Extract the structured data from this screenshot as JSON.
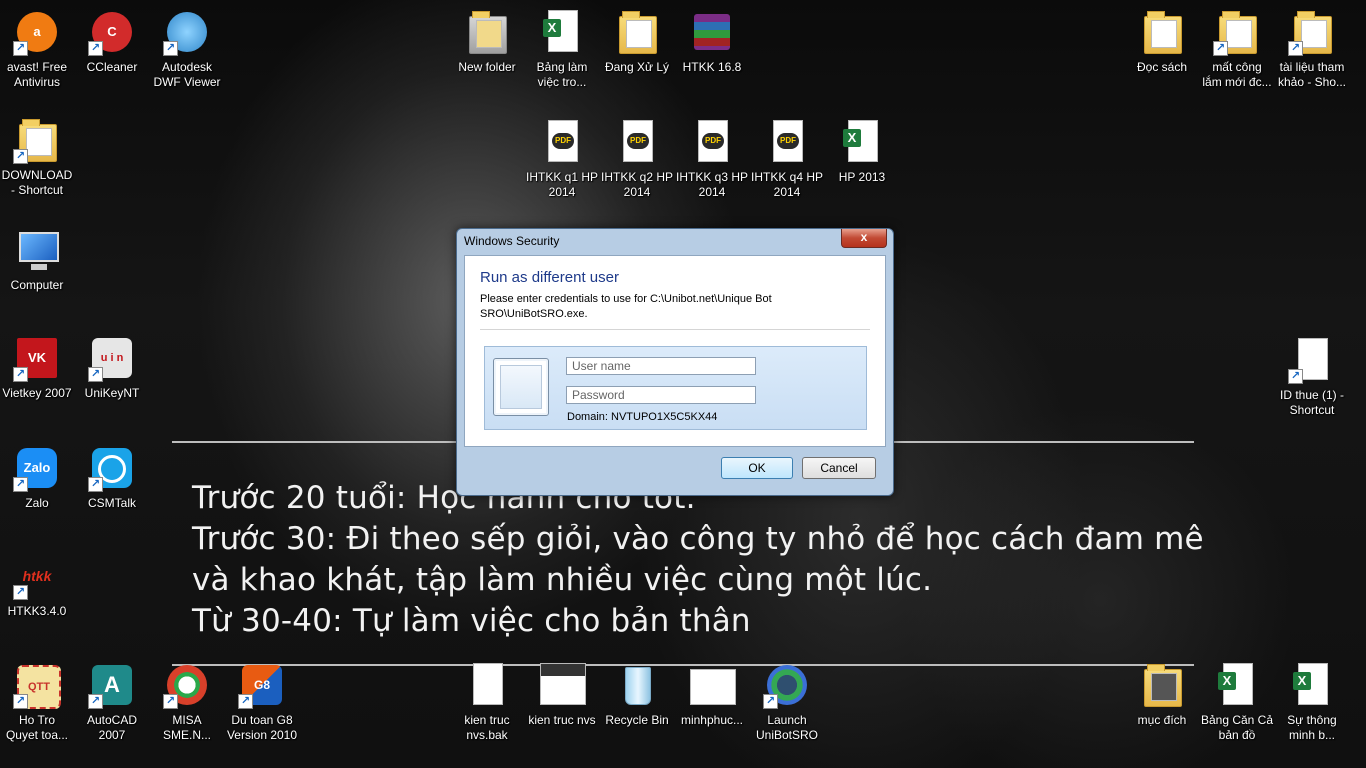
{
  "desktop": {
    "icons_left": [
      {
        "label": "avast! Free\nAntivirus",
        "icon": "avast-icon",
        "color": "#f07b12"
      },
      {
        "label": "CCleaner",
        "icon": "ccleaner-icon",
        "color": "#d22b2b"
      },
      {
        "label": "Autodesk\nDWF Viewer",
        "icon": "dwf-viewer-icon",
        "color": "#2f86c9"
      },
      {
        "label": "DOWNLOAD\n- Shortcut",
        "icon": "folder-icon"
      },
      {
        "label": "Computer",
        "icon": "computer-icon"
      },
      {
        "label": "Vietkey 2007",
        "icon": "vietkey-icon",
        "text": "VK",
        "color": "#c3161c"
      },
      {
        "label": "UniKeyNT",
        "icon": "unikey-icon",
        "text": "u i n",
        "color": "#d9d9d9"
      },
      {
        "label": "Zalo",
        "icon": "zalo-icon",
        "text": "Zalo",
        "color": "#1b8ef5"
      },
      {
        "label": "CSMTalk",
        "icon": "csmtalk-icon",
        "text": "",
        "color": "#1aa3e8"
      },
      {
        "label": "HTKK3.4.0",
        "icon": "htkk-icon",
        "text": "htkk",
        "color": "#e0301e"
      },
      {
        "label": "Ho Tro\nQuyet toa...",
        "icon": "ho-tro-icon",
        "text": "QTT",
        "color": "#c8332b"
      },
      {
        "label": "AutoCAD\n2007",
        "icon": "autocad-icon",
        "text": "A",
        "color": "#1f8a8a"
      },
      {
        "label": "MISA\nSME.N...",
        "icon": "misa-icon",
        "text": "",
        "color": "#d8402a"
      },
      {
        "label": "Du toan G8\nVersion 2010",
        "icon": "du-toan-icon",
        "text": "G8",
        "color": "#e85b12"
      }
    ],
    "icons_top": [
      {
        "label": "New folder",
        "icon": "folder-icon"
      },
      {
        "label": "Bảng làm\nviệc tro...",
        "icon": "excel-icon"
      },
      {
        "label": "Đang Xử Lý",
        "icon": "folder-icon"
      },
      {
        "label": "HTKK  16.8",
        "icon": "winrar-icon"
      },
      {
        "label": "IHTKK q1 HP\n2014",
        "icon": "pdf-icon"
      },
      {
        "label": "IHTKK q2 HP\n2014",
        "icon": "pdf-icon"
      },
      {
        "label": "IHTKK q3 HP\n2014",
        "icon": "pdf-icon"
      },
      {
        "label": "IHTKK q4 HP\n2014",
        "icon": "pdf-icon"
      },
      {
        "label": "HP 2013",
        "icon": "excel-icon"
      }
    ],
    "icons_right": [
      {
        "label": "Đọc sách",
        "icon": "folder-icon"
      },
      {
        "label": "mất công\nlắm mới đc...",
        "icon": "folder-icon"
      },
      {
        "label": "tài liệu tham\nkhảo - Sho...",
        "icon": "folder-icon"
      },
      {
        "label": "ID thue (1) -\nShortcut",
        "icon": "document-icon"
      },
      {
        "label": "mục đích",
        "icon": "folder-icon"
      },
      {
        "label": "Bảng Căn Cả\nbản đồ",
        "icon": "excel-icon"
      },
      {
        "label": "Sự thông\nminh b...",
        "icon": "excel-icon"
      }
    ],
    "icons_bottom": [
      {
        "label": "kien truc\nnvs.bak",
        "icon": "document-icon"
      },
      {
        "label": "kien truc nvs",
        "icon": "image-icon"
      },
      {
        "label": "Recycle Bin",
        "icon": "recycle-bin-icon"
      },
      {
        "label": "minhphuc...",
        "icon": "image-icon"
      },
      {
        "label": "Launch\nUniBotSRO",
        "icon": "unibot-icon"
      }
    ],
    "wallpaper_quote": [
      "Trước 20 tuổi: Học hành cho tốt.",
      "Trước 30: Đi theo sếp giỏi, vào công ty nhỏ để học cách đam mê",
      "và khao khát, tập làm nhiều việc cùng một lúc.",
      "Từ 30-40: Tự làm việc cho bản thân"
    ]
  },
  "dialog": {
    "title": "Windows Security",
    "close_label": "x",
    "heading": "Run as different user",
    "description": "Please enter credentials to use for C:\\Unibot.net\\Unique Bot SRO\\UniBotSRO.exe.",
    "username_placeholder": "User name",
    "password_placeholder": "Password",
    "domain": "Domain: NVTUPO1X5C5KX44",
    "ok_label": "OK",
    "cancel_label": "Cancel"
  }
}
